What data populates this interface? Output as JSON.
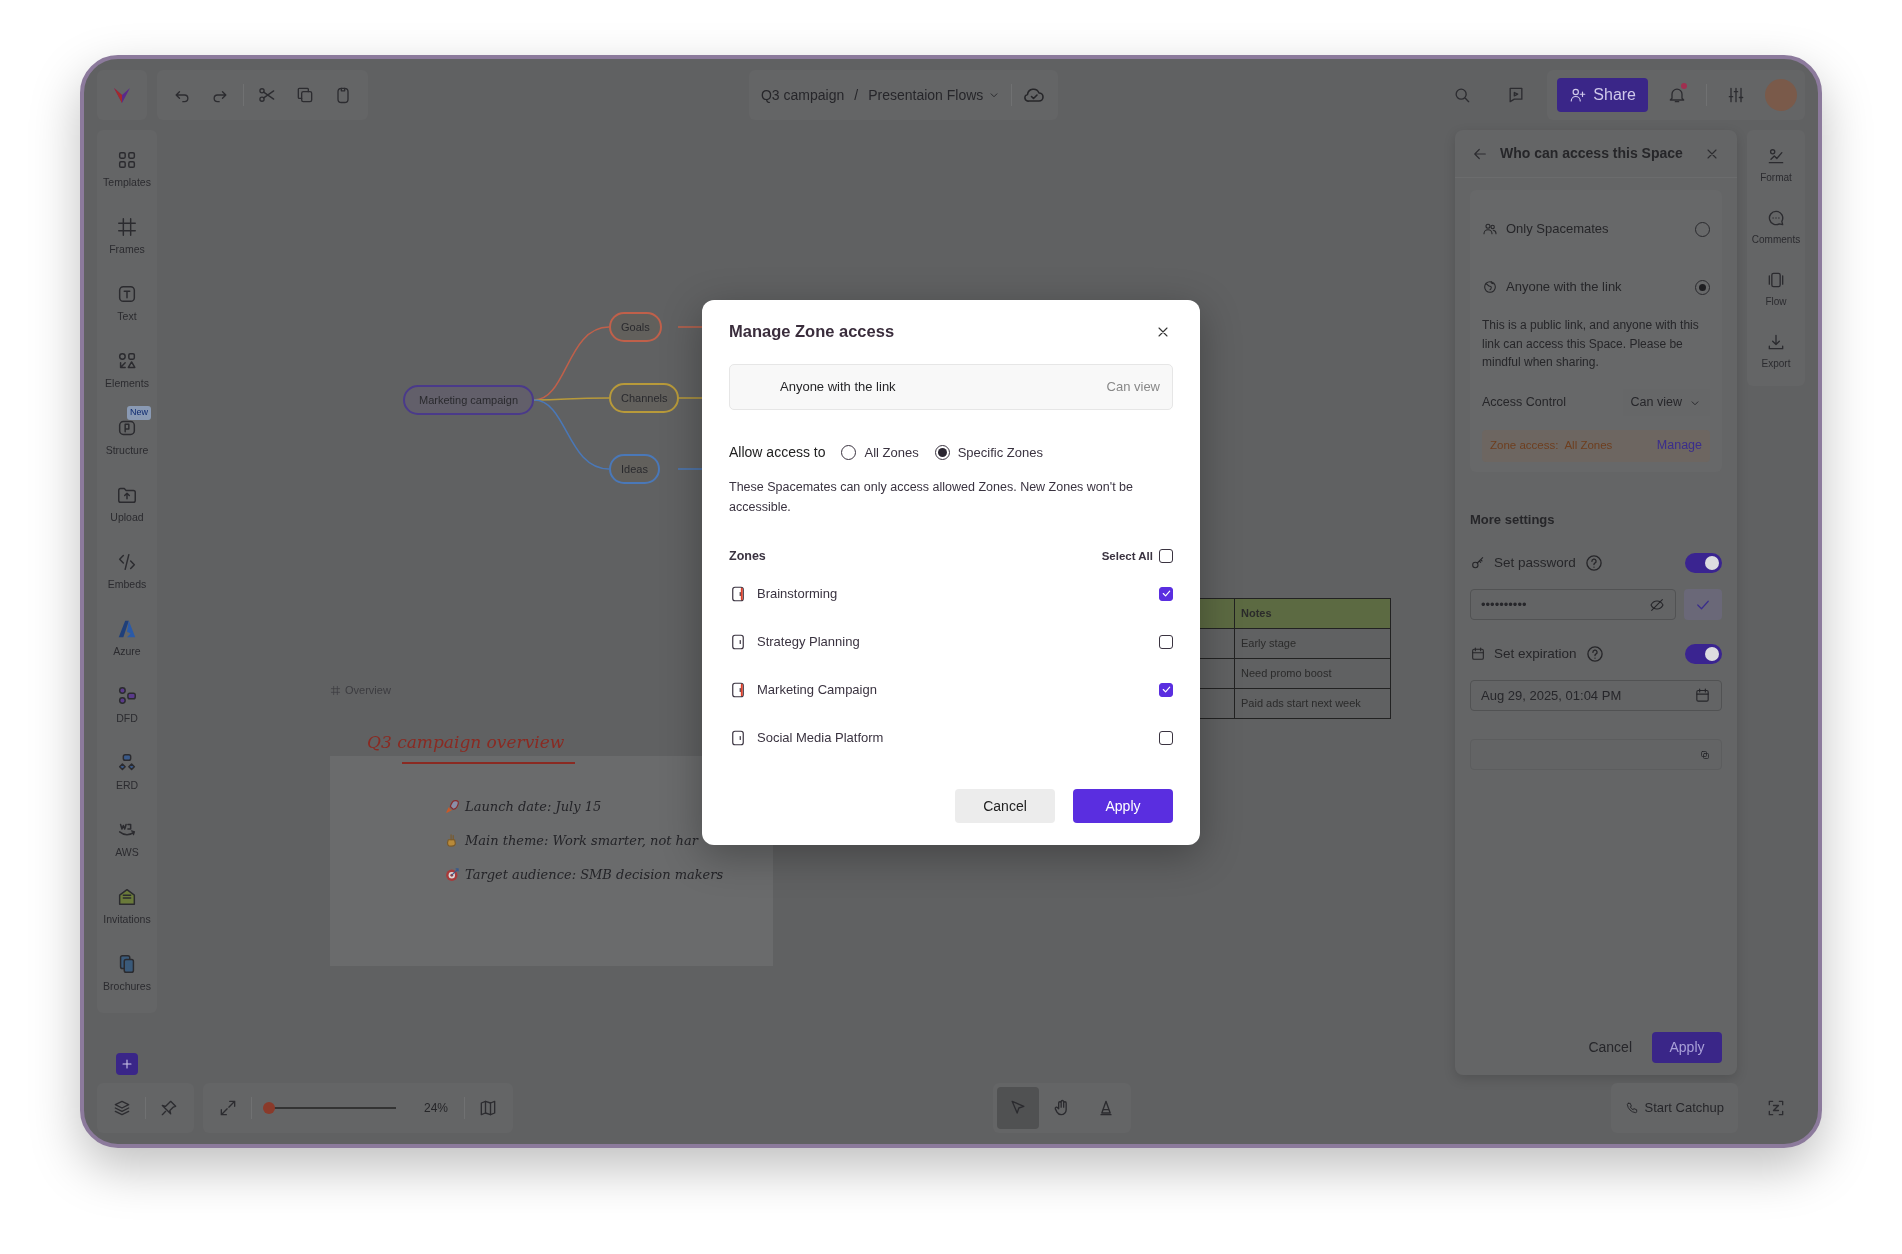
{
  "top_bar": {
    "breadcrumb": [
      "Q3 campaign",
      "Presentaion Flows"
    ],
    "separator": "/",
    "share_button": "Share"
  },
  "left_sidebar": {
    "items": [
      {
        "label": "Templates"
      },
      {
        "label": "Frames"
      },
      {
        "label": "Text"
      },
      {
        "label": "Elements"
      },
      {
        "label": "Structure",
        "badge": "New"
      },
      {
        "label": "Upload"
      },
      {
        "label": "Embeds"
      },
      {
        "label": "Azure"
      },
      {
        "label": "DFD"
      },
      {
        "label": "ERD"
      },
      {
        "label": "AWS"
      },
      {
        "label": "Invitations"
      },
      {
        "label": "Brochures"
      }
    ]
  },
  "canvas": {
    "mind_map": {
      "root": "Marketing campaign",
      "children": [
        {
          "label": "Goals",
          "color": "#c0604a"
        },
        {
          "label": "Channels",
          "color": "#b89a3a"
        },
        {
          "label": "Ideas",
          "color": "#4a78b8"
        }
      ]
    },
    "frame_label": "Overview",
    "note": {
      "title": "Q3 campaign overview",
      "lines": [
        "Launch date: July 15",
        "Main theme: Work smarter, not har",
        "Target audience: SMB decision makers"
      ]
    },
    "table": {
      "columns": [
        "",
        "Notes"
      ],
      "rows": [
        [
          "",
          "Early stage"
        ],
        [
          "",
          "Need promo boost"
        ],
        [
          "",
          "Paid ads start next week"
        ]
      ]
    }
  },
  "share_panel": {
    "title": "Who can access this Space",
    "options": [
      {
        "label": "Only Spacemates",
        "selected": false
      },
      {
        "label": "Anyone with the link",
        "selected": true,
        "description": "This is a public link, and anyone with this link can access this Space. Please be mindful when sharing."
      }
    ],
    "access_control": {
      "label": "Access Control",
      "value": "Can view"
    },
    "zone_access": {
      "label": "Zone access:",
      "value": "All Zones",
      "action": "Manage"
    },
    "more_settings": "More settings",
    "password": {
      "label": "Set password",
      "on": true,
      "value": "••••••••••"
    },
    "expiration": {
      "label": "Set expiration",
      "on": true,
      "value": "Aug 29, 2025, 01:04 PM"
    },
    "buttons": [
      "Cancel",
      "Apply"
    ]
  },
  "right_toolbar": {
    "items": [
      "Format",
      "Comments",
      "Flow",
      "Export"
    ]
  },
  "bottom_bar": {
    "zoom": {
      "level": 0.02,
      "reading": "24%"
    },
    "tools": [
      {
        "selected": true
      },
      {
        "selected": false
      },
      {
        "selected": false
      }
    ],
    "catchup_button": "Start Catchup"
  },
  "modal": {
    "title": "Manage Zone access",
    "audience": {
      "label": "Anyone with the link",
      "permission": "Can view"
    },
    "allow_label": "Allow access to",
    "scope_options": [
      {
        "label": "All Zones",
        "selected": false
      },
      {
        "label": "Specific Zones",
        "selected": true
      }
    ],
    "note": "These Spacemates can only access allowed Zones. New Zones won't be accessible.",
    "zones_heading": "Zones",
    "select_all": {
      "label": "Select All",
      "checked": false
    },
    "zones": [
      {
        "name": "Brainstorming",
        "checked": true
      },
      {
        "name": "Strategy Planning",
        "checked": false
      },
      {
        "name": "Marketing Campaign",
        "checked": true
      },
      {
        "name": "Social Media Platform",
        "checked": false
      }
    ],
    "buttons": [
      {
        "label": "Cancel",
        "kind": "secondary"
      },
      {
        "label": "Apply",
        "kind": "primary"
      }
    ]
  }
}
